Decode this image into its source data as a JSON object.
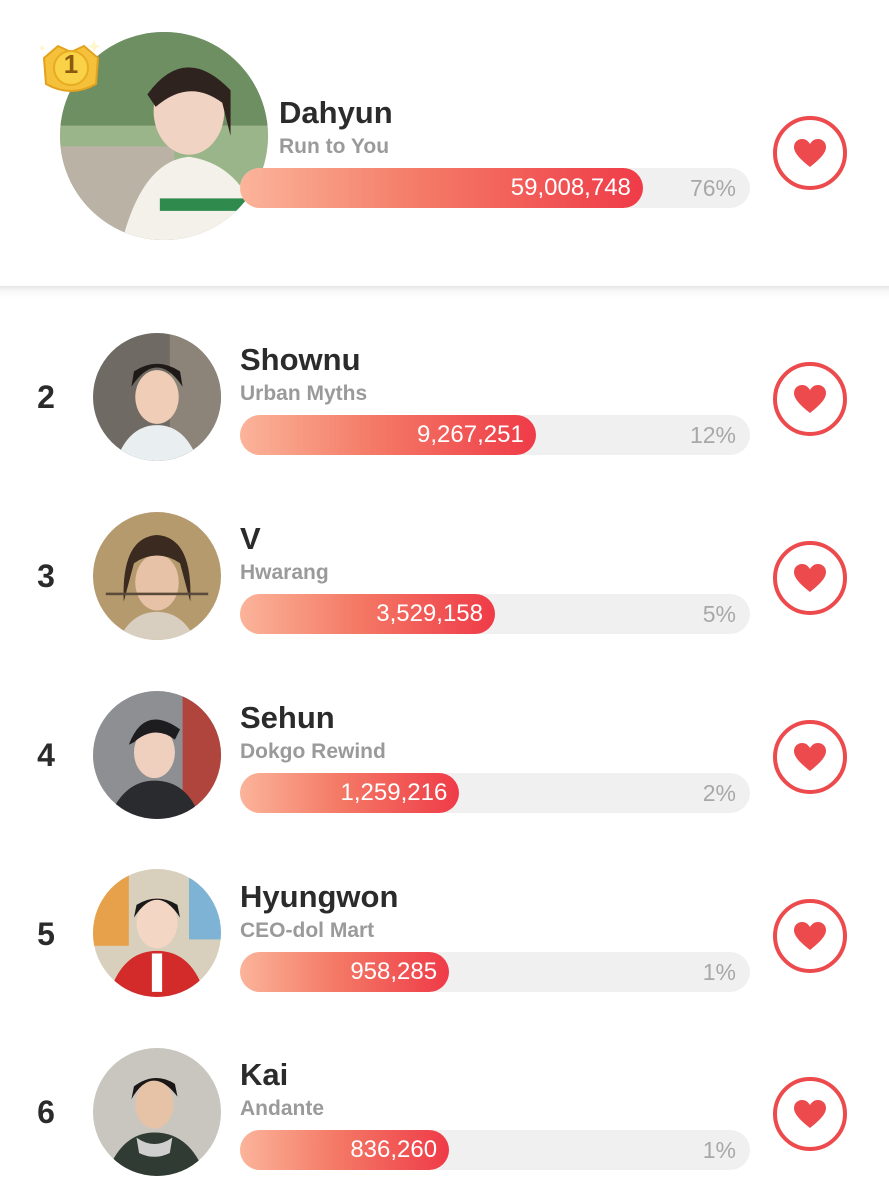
{
  "entries": [
    {
      "rank": "1",
      "name": "Dahyun",
      "title": "Run to You",
      "votes": "59,008,748",
      "percent": "76%",
      "fill": 0.79
    },
    {
      "rank": "2",
      "name": "Shownu",
      "title": "Urban Myths",
      "votes": "9,267,251",
      "percent": "12%",
      "fill": 0.58
    },
    {
      "rank": "3",
      "name": "V",
      "title": "Hwarang",
      "votes": "3,529,158",
      "percent": "5%",
      "fill": 0.5
    },
    {
      "rank": "4",
      "name": "Sehun",
      "title": "Dokgo Rewind",
      "votes": "1,259,216",
      "percent": "2%",
      "fill": 0.43
    },
    {
      "rank": "5",
      "name": "Hyungwon",
      "title": "CEO-dol Mart",
      "votes": "958,285",
      "percent": "1%",
      "fill": 0.41
    },
    {
      "rank": "6",
      "name": "Kai",
      "title": "Andante",
      "votes": "836,260",
      "percent": "1%",
      "fill": 0.41
    }
  ],
  "colors": {
    "accent": "#ec4a4c",
    "bar_start": "#fbb49a",
    "bar_end": "#ef3b48",
    "track": "#f0f0f0"
  },
  "icons": {
    "vote": "heart-icon",
    "top_badge": "gold-crown-icon"
  }
}
